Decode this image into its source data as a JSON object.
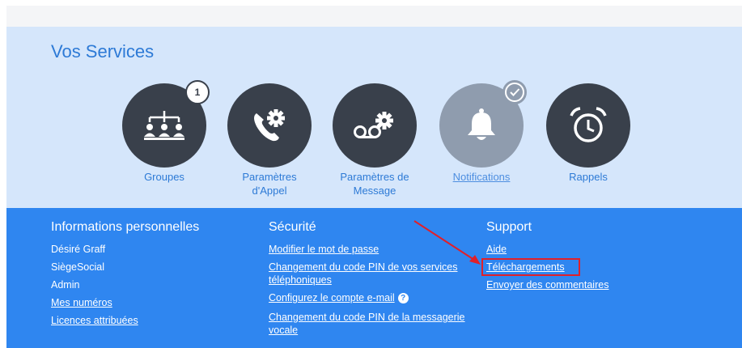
{
  "services": {
    "title": "Vos Services",
    "items": [
      {
        "label": "Groupes",
        "icon": "hierarchy-icon",
        "badge": "1"
      },
      {
        "label": "Paramètres d'Appel",
        "icon": "phone-gear-icon"
      },
      {
        "label": "Paramètres de Message",
        "icon": "voicemail-gear-icon"
      },
      {
        "label": "Notifications",
        "icon": "bell-icon",
        "badge": "check"
      },
      {
        "label": "Rappels",
        "icon": "alarm-clock-icon"
      }
    ]
  },
  "footer": {
    "personal": {
      "title": "Informations personnelles",
      "items": [
        "Désiré Graff",
        "SiègeSocial",
        "Admin",
        "Mes numéros",
        "Licences attribuées"
      ]
    },
    "security": {
      "title": "Sécurité",
      "items": [
        "Modifier le mot de passe",
        "Changement du code PIN de vos services téléphoniques",
        "Configurez le compte e-mail",
        "Changement du code PIN de la messagerie vocale"
      ]
    },
    "support": {
      "title": "Support",
      "items": [
        "Aide",
        "Téléchargements",
        "Envoyer des commentaires"
      ]
    }
  },
  "colors": {
    "footer_bg": "#2f86f0",
    "services_bg": "#d5e6fb",
    "circle": "#39404b",
    "annotation": "#e0202a"
  }
}
